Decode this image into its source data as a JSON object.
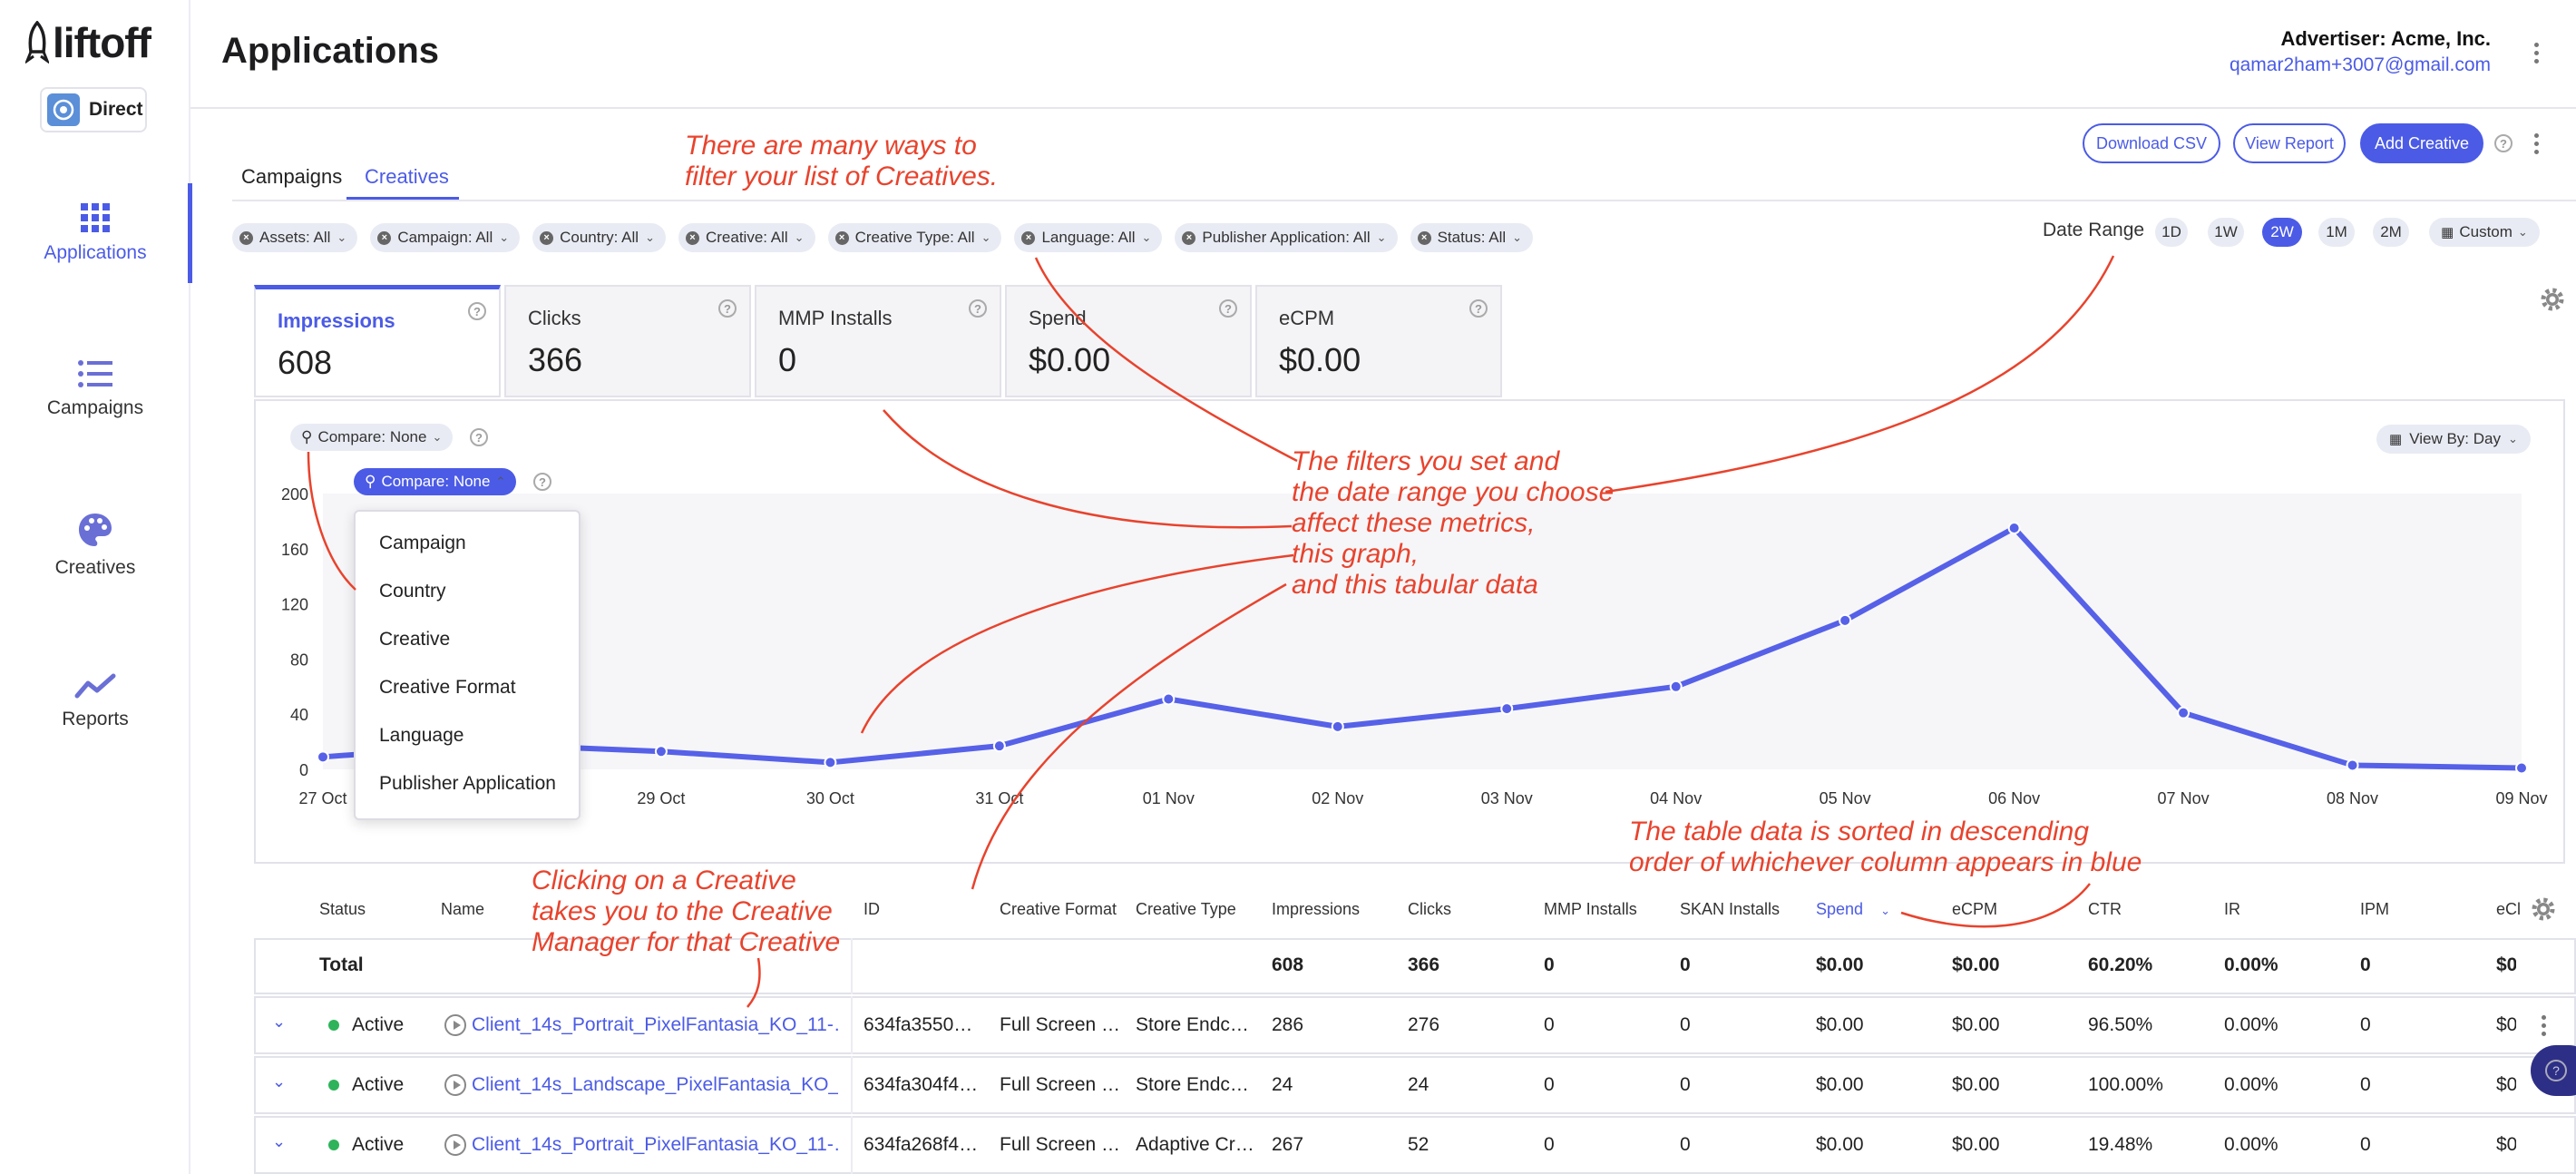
{
  "brand": {
    "logo_text": "liftoff",
    "account_type": "Direct"
  },
  "sidebar": {
    "items": [
      {
        "label": "Applications",
        "icon": "grid-icon",
        "active": true
      },
      {
        "label": "Campaigns",
        "icon": "list-icon",
        "active": false
      },
      {
        "label": "Creatives",
        "icon": "palette-icon",
        "active": false
      },
      {
        "label": "Reports",
        "icon": "trend-icon",
        "active": false
      }
    ]
  },
  "header": {
    "title": "Applications",
    "advertiser": "Advertiser: Acme, Inc.",
    "email": "qamar2ham+3007@gmail.com"
  },
  "tabs": [
    {
      "label": "Campaigns"
    },
    {
      "label": "Creatives",
      "active": true
    }
  ],
  "toolbar": {
    "download_csv": "Download CSV",
    "view_report": "View Report",
    "add_creative": "Add Creative"
  },
  "filters": [
    "Assets: All",
    "Campaign: All",
    "Country: All",
    "Creative: All",
    "Creative Type: All",
    "Language: All",
    "Publisher Application: All",
    "Status: All"
  ],
  "date_range": {
    "label": "Date Range",
    "options": [
      "1D",
      "1W",
      "2W",
      "1M",
      "2M"
    ],
    "selected": "2W",
    "custom": "Custom"
  },
  "metrics": [
    {
      "label": "Impressions",
      "value": "608",
      "active": true
    },
    {
      "label": "Clicks",
      "value": "366"
    },
    {
      "label": "MMP Installs",
      "value": "0"
    },
    {
      "label": "Spend",
      "value": "$0.00"
    },
    {
      "label": "eCPM",
      "value": "$0.00"
    }
  ],
  "chart": {
    "compare_label": "Compare: None",
    "view_by": "View By: Day",
    "dropdown_options": [
      "Campaign",
      "Country",
      "Creative",
      "Creative Format",
      "Language",
      "Publisher Application"
    ]
  },
  "chart_data": {
    "type": "line",
    "categories": [
      "27 Oct",
      "28 Oct",
      "29 Oct",
      "30 Oct",
      "31 Oct",
      "01 Nov",
      "02 Nov",
      "03 Nov",
      "04 Nov",
      "05 Nov",
      "06 Nov",
      "07 Nov",
      "08 Nov",
      "09 Nov"
    ],
    "x_tick_labels": [
      "27 Oct",
      "29 Oct",
      "30 Oct",
      "31 Oct",
      "01 Nov",
      "02 Nov",
      "03 Nov",
      "04 Nov",
      "05 Nov",
      "06 Nov",
      "07 Nov",
      "08 Nov",
      "09 Nov"
    ],
    "values": [
      9,
      18,
      13,
      5,
      17,
      51,
      31,
      44,
      60,
      108,
      175,
      41,
      3,
      1
    ],
    "yticks": [
      0,
      40,
      80,
      120,
      160,
      200
    ],
    "ylim": [
      0,
      200
    ],
    "color": "#5661e8",
    "grid": false
  },
  "annotations": {
    "filters": "There are many ways to\nfilter your list of Creatives.",
    "affect": "The filters you set and\nthe date range you choose\naffect these metrics,\nthis graph,\nand this tabular data",
    "sorted": "The table data is sorted in descending\norder of whichever column appears in blue",
    "clicking": "Clicking on a Creative\ntakes you to the Creative\nManager for that Creative"
  },
  "table": {
    "columns": [
      "Status",
      "Name",
      "ID",
      "Creative Format",
      "Creative Type",
      "Impressions",
      "Clicks",
      "MMP Installs",
      "SKAN Installs",
      "Spend",
      "eCPM",
      "CTR",
      "IR",
      "IPM",
      "eCl"
    ],
    "sorted_column": "Spend",
    "total": {
      "label": "Total",
      "values": [
        "608",
        "366",
        "0",
        "0",
        "$0.00",
        "$0.00",
        "60.20%",
        "0.00%",
        "0",
        "$0"
      ]
    },
    "rows": [
      {
        "status": "Active",
        "name": "Client_14s_Portrait_PixelFantasia_KO_11-…",
        "id": "634fa3550…",
        "format": "Full Screen …",
        "type": "Store Endc…",
        "values": [
          "286",
          "276",
          "0",
          "0",
          "$0.00",
          "$0.00",
          "96.50%",
          "0.00%",
          "0",
          "$0"
        ]
      },
      {
        "status": "Active",
        "name": "Client_14s_Landscape_PixelFantasia_KO_…",
        "id": "634fa304f4…",
        "format": "Full Screen …",
        "type": "Store Endc…",
        "values": [
          "24",
          "24",
          "0",
          "0",
          "$0.00",
          "$0.00",
          "100.00%",
          "0.00%",
          "0",
          "$0"
        ]
      },
      {
        "status": "Active",
        "name": "Client_14s_Portrait_PixelFantasia_KO_11-…",
        "id": "634fa268f4…",
        "format": "Full Screen …",
        "type": "Adaptive Cr…",
        "values": [
          "267",
          "52",
          "0",
          "0",
          "$0.00",
          "$0.00",
          "19.48%",
          "0.00%",
          "0",
          "$0"
        ]
      }
    ]
  }
}
